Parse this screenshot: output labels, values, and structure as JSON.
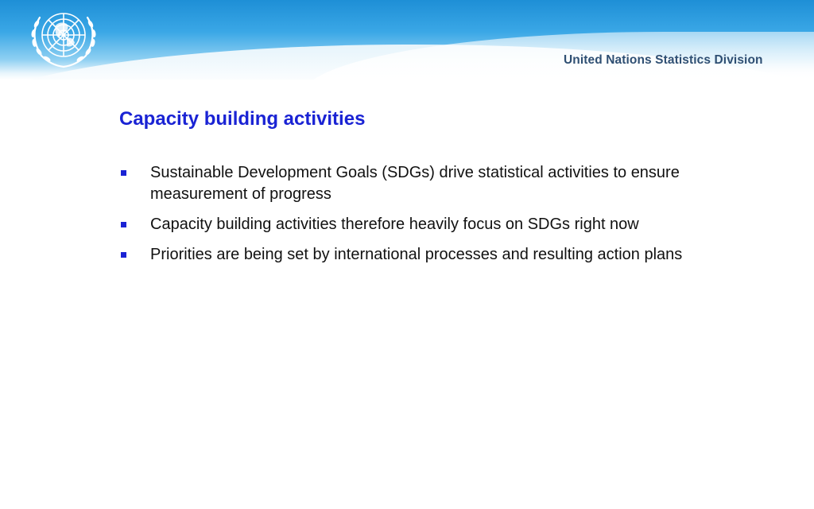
{
  "header": {
    "org_name": "United Nations Statistics Division",
    "logo_icon": "un-emblem-icon",
    "colors": {
      "band_top": "#1e8fd6",
      "band_light": "#8fd0f2",
      "emblem": "#ffffff"
    }
  },
  "slide": {
    "title": "Capacity building activities",
    "title_color": "#1a23d4",
    "bullet_marker": "square",
    "bullets": [
      {
        "text": "Sustainable Development Goals (SDGs) drive statistical activities to ensure measurement of progress"
      },
      {
        "text": "Capacity building activities therefore heavily focus on SDGs right now"
      },
      {
        "text": "Priorities are being set by international processes and resulting action plans"
      }
    ]
  }
}
